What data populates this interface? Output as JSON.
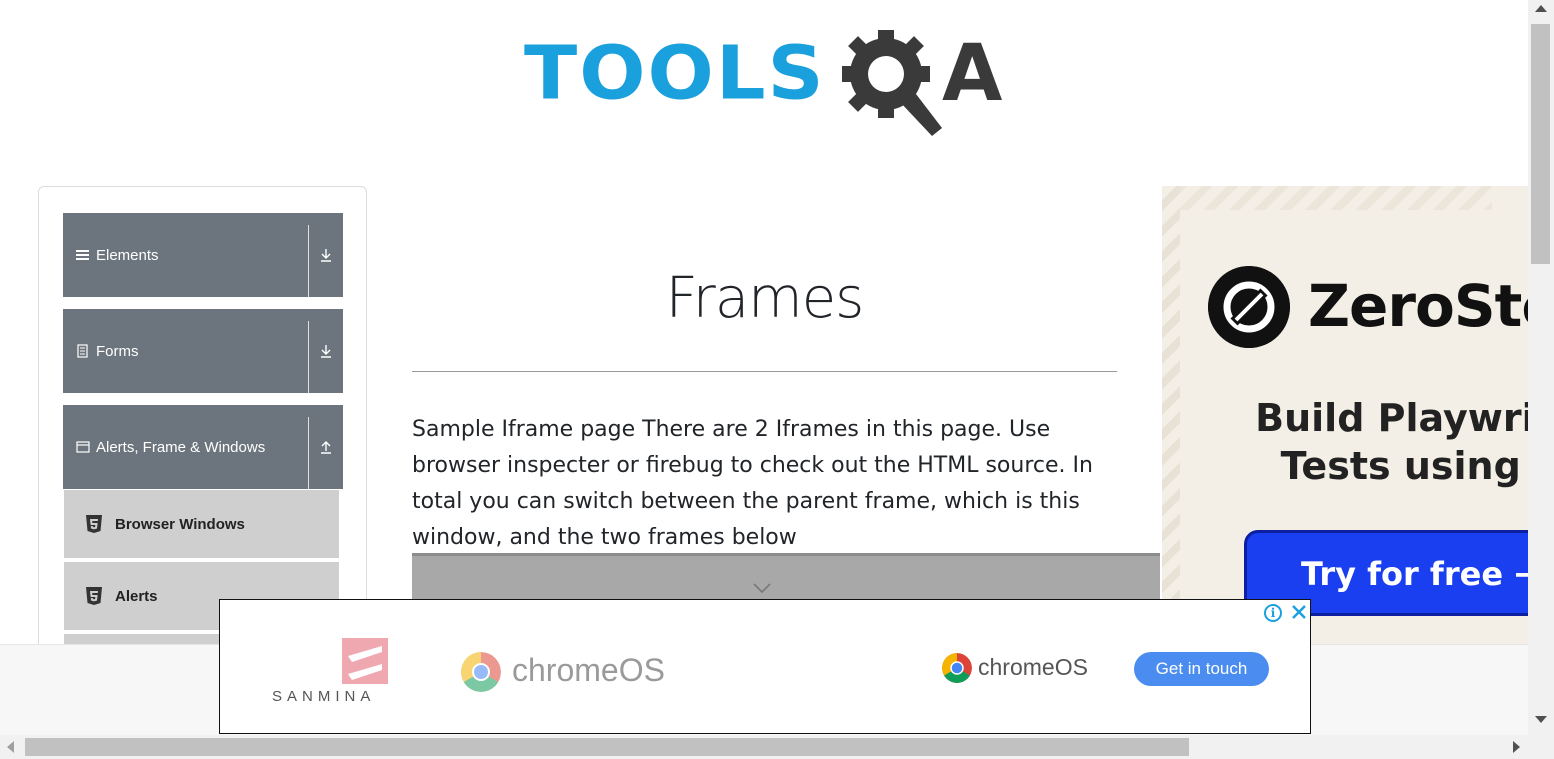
{
  "logo": {
    "tools": "TOOLS",
    "a": "A",
    "alt": "ToolsQA"
  },
  "sidebar": {
    "groups": [
      {
        "label": "Elements",
        "icon": "hamburger-icon",
        "arrow": "download-icon"
      },
      {
        "label": "Forms",
        "icon": "document-icon",
        "arrow": "download-icon"
      },
      {
        "label": "Alerts, Frame & Windows",
        "icon": "window-icon",
        "arrow": "upload-icon"
      }
    ],
    "items": [
      {
        "label": "Browser Windows",
        "icon": "html5-icon"
      },
      {
        "label": "Alerts",
        "icon": "html5-icon"
      }
    ]
  },
  "main": {
    "title": "Frames",
    "description": "Sample Iframe page There are 2 Iframes in this page. Use browser inspecter or firebug to check out the HTML source. In total you can switch between the parent frame, which is this window, and the two frames below"
  },
  "right_ad": {
    "brand": "ZeroSte",
    "headline_1": "Build Playwrigh",
    "headline_2": "Tests using A",
    "cta": "Try for free →"
  },
  "bottom_ad": {
    "sanmina": "SANMINA",
    "chromeos_1": "chromeOS",
    "chromeos_2": "chromeOS",
    "cta": "Get in touch",
    "info": "i"
  },
  "colors": {
    "brand_blue": "#1aa0dc",
    "sidebar_header": "#6c757d",
    "sidebar_item": "#cfcfcf",
    "cta_blue": "#1a3ff0",
    "get_in_touch": "#4a8cf0"
  }
}
